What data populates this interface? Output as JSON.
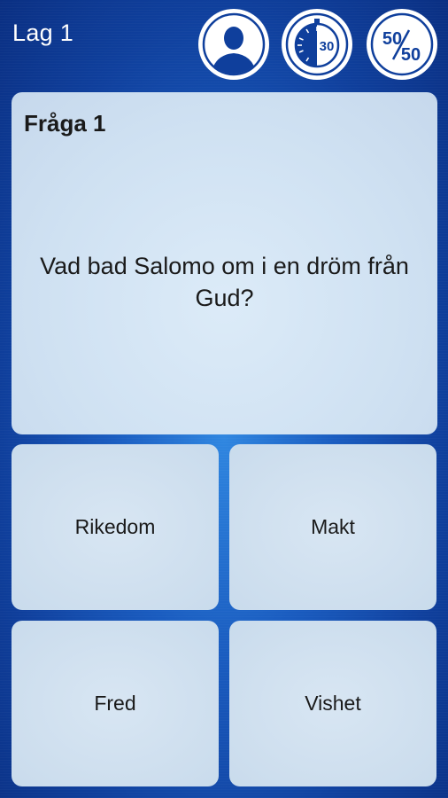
{
  "team": {
    "label": "Lag 1"
  },
  "lifelines": {
    "phone": {
      "icon": "person-icon"
    },
    "timer": {
      "icon": "stopwatch-icon",
      "seconds": "30"
    },
    "fifty": {
      "icon": "fifty-fifty-icon",
      "top": "50",
      "bottom": "50"
    }
  },
  "question": {
    "label": "Fråga 1",
    "text": "Vad bad Salomo om i en dröm från Gud?"
  },
  "answers": [
    {
      "label": "Rikedom"
    },
    {
      "label": "Makt"
    },
    {
      "label": "Fred"
    },
    {
      "label": "Vishet"
    }
  ],
  "colors": {
    "background": "#1a5cc0",
    "card": "#d4e5f5",
    "lifeline_ring": "#0f3f9c"
  }
}
